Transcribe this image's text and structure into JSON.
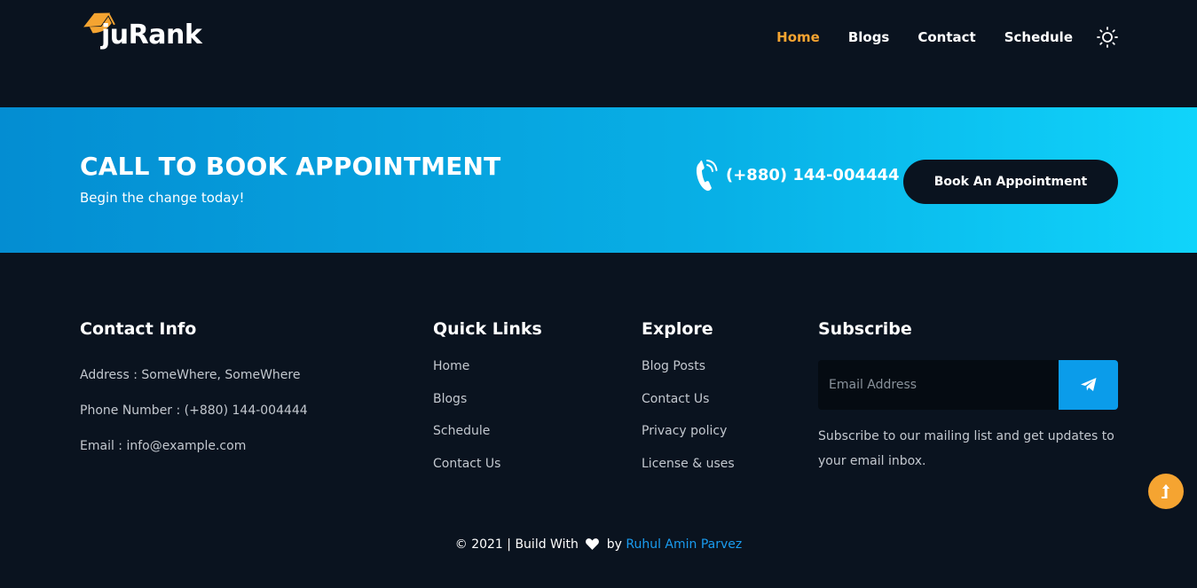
{
  "brand": {
    "name": "juRank",
    "accent_color": "#f5a431"
  },
  "nav": {
    "items": [
      {
        "label": "Home",
        "active": true
      },
      {
        "label": "Blogs"
      },
      {
        "label": "Contact"
      },
      {
        "label": "Schedule"
      }
    ],
    "theme_icon": "sun-icon"
  },
  "cta": {
    "title": "CALL TO BOOK APPOINTMENT",
    "subtitle": "Begin the change today!",
    "phone": "(+880) 144-004444",
    "phone_icon": "phone-call-icon",
    "button_label": "Book An Appointment",
    "gradient": [
      "#048dd2",
      "#10d4fb"
    ]
  },
  "footer": {
    "contact": {
      "heading": "Contact Info",
      "address": "Address : SomeWhere, SomeWhere",
      "phone": "Phone Number : (+880) 144-004444",
      "email": "Email : info@example.com"
    },
    "quick_links": {
      "heading": "Quick Links",
      "items": [
        "Home",
        "Blogs",
        "Schedule",
        "Contact Us"
      ]
    },
    "explore": {
      "heading": "Explore",
      "items": [
        "Blog Posts",
        "Contact Us",
        "Privacy policy",
        "License & uses"
      ]
    },
    "subscribe": {
      "heading": "Subscribe",
      "placeholder": "Email Address",
      "button_icon": "paper-plane-icon",
      "text": "Subscribe to our mailing list and get updates to your email inbox."
    },
    "copyright": {
      "prefix": "© 2021 | Build With",
      "by": "by",
      "author": "Ruhul Amin Parvez"
    }
  },
  "scroll_top_icon": "arrow-up-icon",
  "colors": {
    "background": "#0a131f",
    "link": "#1a9cf0",
    "button_blue": "#0b9cea"
  }
}
